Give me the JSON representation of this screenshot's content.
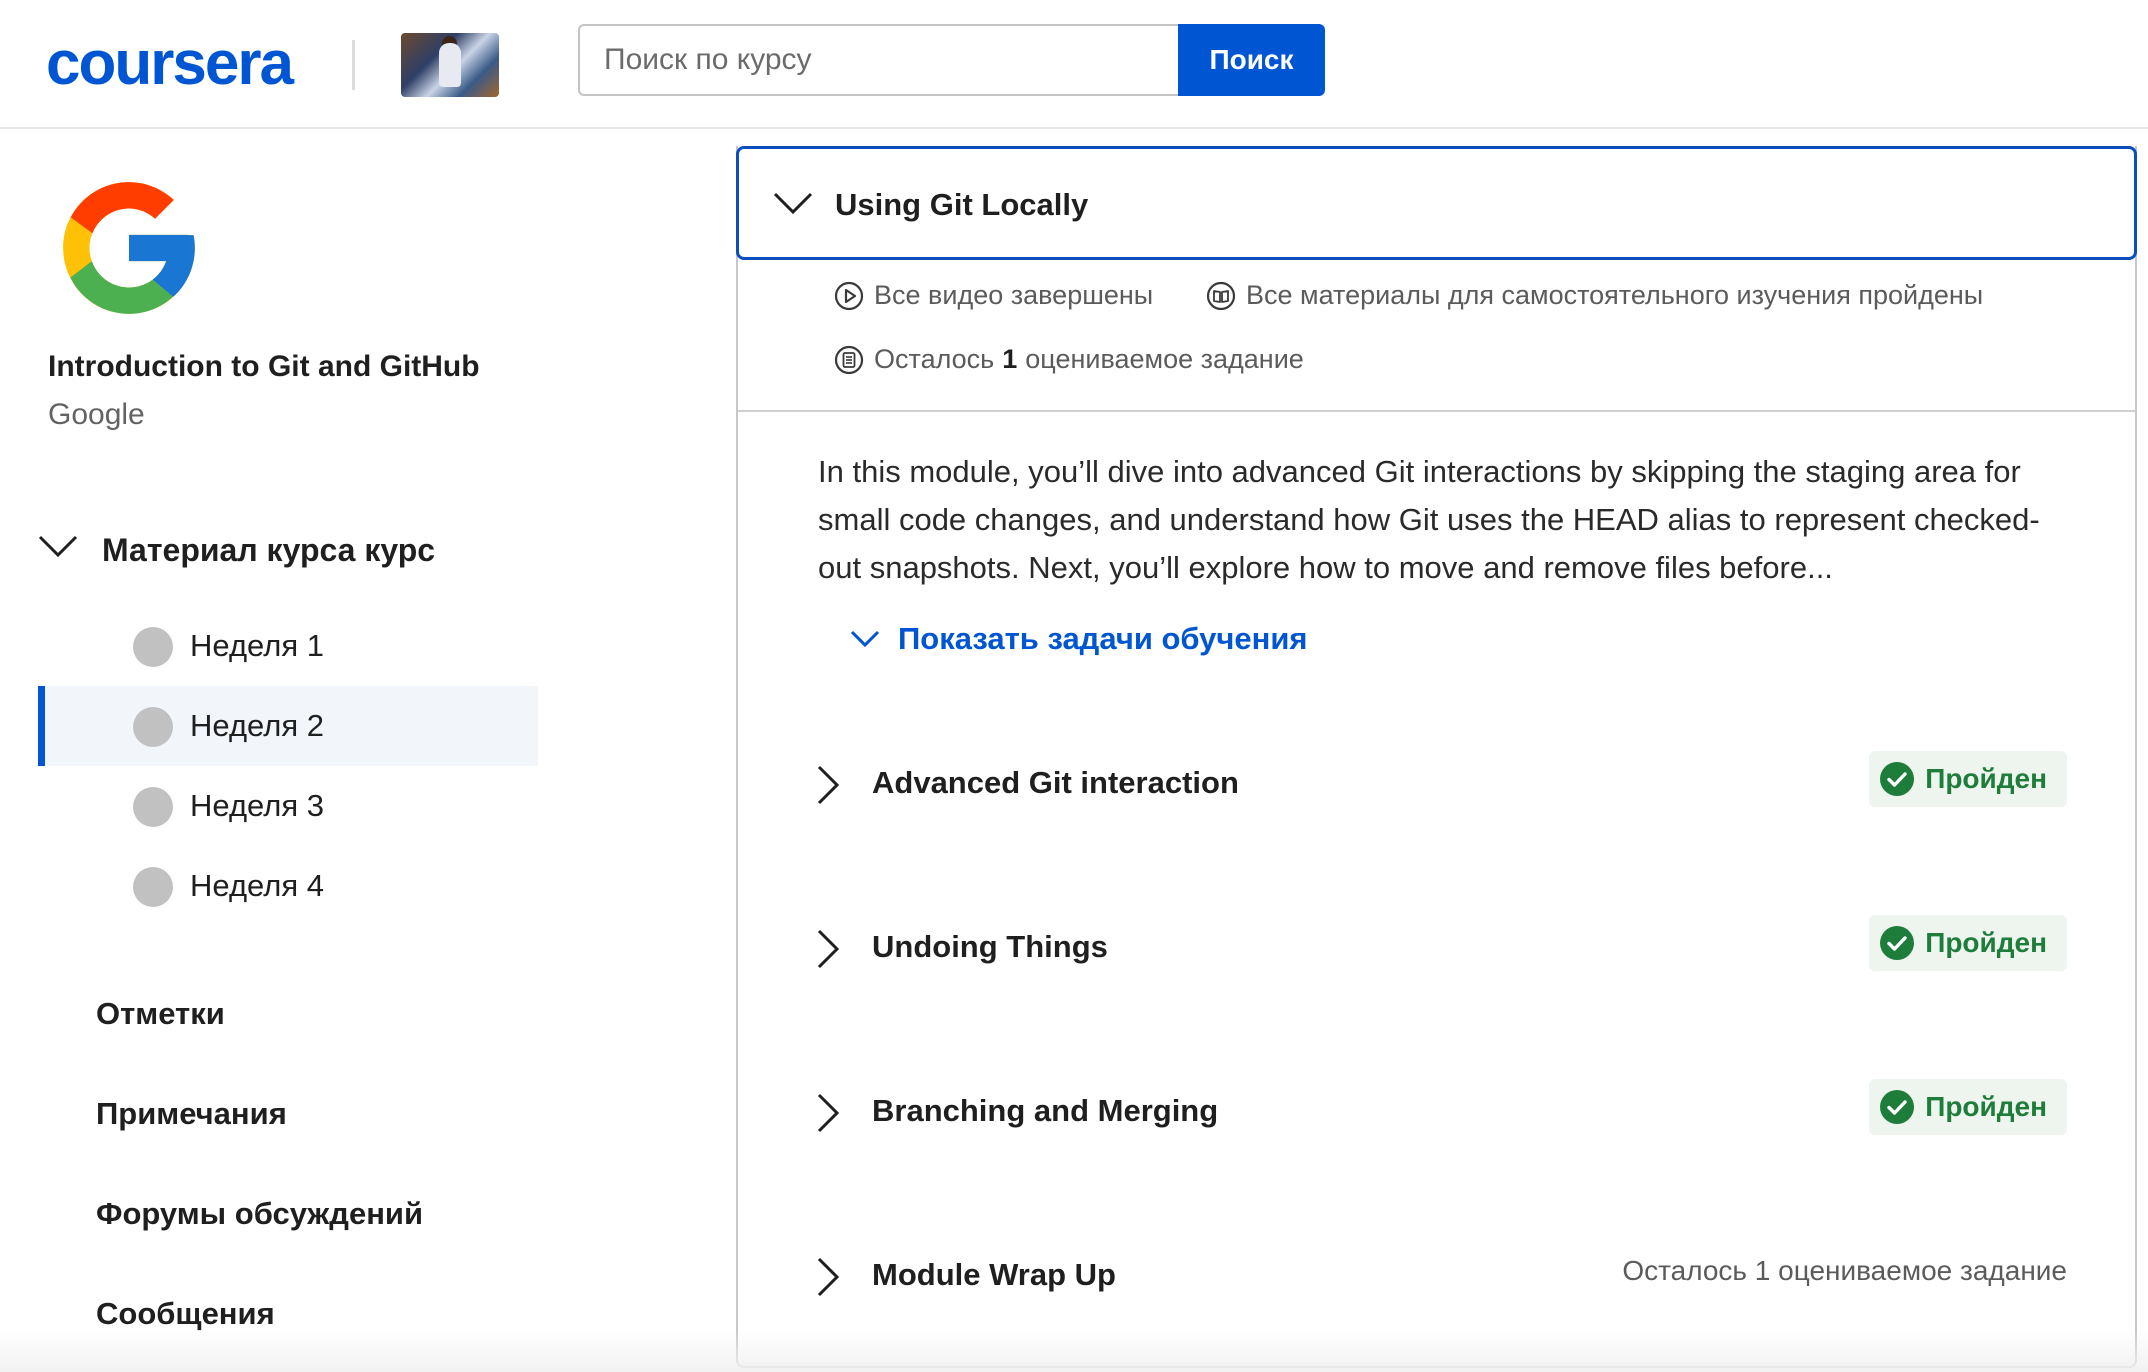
{
  "header": {
    "logo_text": "coursera",
    "search": {
      "placeholder": "Поиск по курсу",
      "value": ""
    },
    "search_button_label": "Поиск"
  },
  "sidebar": {
    "course_title": "Introduction to Git and GitHub",
    "course_org": "Google",
    "material_label": "Материал курса курс",
    "weeks": [
      {
        "label": "Неделя 1",
        "active": false
      },
      {
        "label": "Неделя 2",
        "active": true
      },
      {
        "label": "Неделя 3",
        "active": false
      },
      {
        "label": "Неделя 4",
        "active": false
      }
    ],
    "links": [
      "Отметки",
      "Примечания",
      "Форумы обсуждений",
      "Сообщения"
    ]
  },
  "module": {
    "title": "Using Git Locally",
    "stats": {
      "videos": "Все видео завершены",
      "materials": "Все материалы для самостоятельного изучения пройдены",
      "remaining_prefix": "Осталось",
      "remaining_count": "1",
      "remaining_suffix": "оцениваемое задание"
    },
    "description": "In this module, you’ll dive into advanced Git interactions by skipping the staging area for small code changes, and understand how Git uses the HEAD alias to represent checked-out snapshots. Next, you’ll explore how to move and remove files before...",
    "show_tasks_label": "Показать задачи обучения",
    "lessons": [
      {
        "title": "Advanced Git interaction",
        "status": "Пройден"
      },
      {
        "title": "Undoing Things",
        "status": "Пройден"
      },
      {
        "title": "Branching and Merging",
        "status": "Пройден"
      },
      {
        "title": "Module Wrap Up",
        "status": "Осталось 1 оцениваемое задание"
      }
    ]
  },
  "colors": {
    "brand_blue": "#0056d2",
    "success_green": "#1e7d3a",
    "badge_bg": "#eef5ef",
    "active_week_bg": "#f2f5fa"
  },
  "icons": [
    "chevron-down-icon",
    "chevron-right-icon",
    "play-circle-icon",
    "book-icon",
    "assignment-icon",
    "check-circle-icon"
  ]
}
